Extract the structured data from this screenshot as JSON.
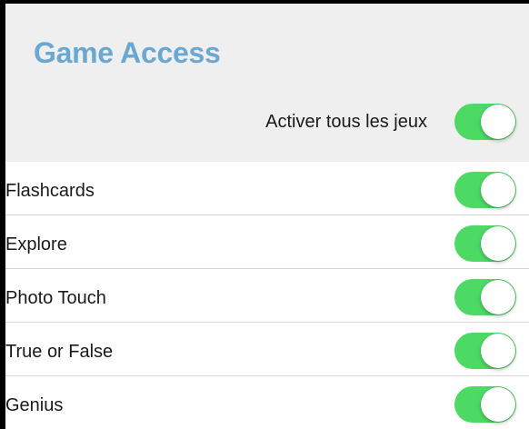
{
  "header": {
    "title": "Game Access",
    "master_toggle": {
      "label": "Activer tous les jeux",
      "on": true
    }
  },
  "games": [
    {
      "label": "Flashcards",
      "on": true
    },
    {
      "label": "Explore",
      "on": true
    },
    {
      "label": "Photo Touch",
      "on": true
    },
    {
      "label": "True or False",
      "on": true
    },
    {
      "label": "Genius",
      "on": true
    }
  ],
  "colors": {
    "title": "#6aa8d2",
    "toggle_on": "#4cd964",
    "header_background": "#efefef",
    "divider": "#d6d6d6"
  }
}
